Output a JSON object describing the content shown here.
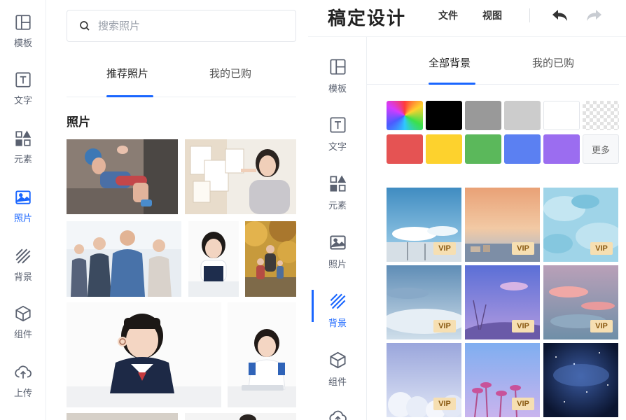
{
  "left_rail": {
    "items": [
      {
        "label": "模板",
        "icon": "layout-icon"
      },
      {
        "label": "文字",
        "icon": "text-icon"
      },
      {
        "label": "元素",
        "icon": "elements-icon"
      },
      {
        "label": "照片",
        "icon": "image-icon"
      },
      {
        "label": "背景",
        "icon": "background-icon"
      },
      {
        "label": "组件",
        "icon": "cube-icon"
      },
      {
        "label": "上传",
        "icon": "upload-icon"
      }
    ],
    "active_index": 3
  },
  "left_panel": {
    "search": {
      "placeholder": "搜索照片",
      "value": ""
    },
    "tabs": [
      {
        "label": "推荐照片"
      },
      {
        "label": "我的已购"
      }
    ],
    "active_tab": 0,
    "section_title": "照片"
  },
  "editor": {
    "brand": "稿定设计",
    "menu": [
      {
        "label": "文件"
      },
      {
        "label": "视图"
      }
    ],
    "right_rail": {
      "items": [
        {
          "label": "模板",
          "icon": "layout-icon"
        },
        {
          "label": "文字",
          "icon": "text-icon"
        },
        {
          "label": "元素",
          "icon": "elements-icon"
        },
        {
          "label": "照片",
          "icon": "image-icon"
        },
        {
          "label": "背景",
          "icon": "background-icon"
        },
        {
          "label": "组件",
          "icon": "cube-icon"
        }
      ],
      "active_index": 4
    },
    "bg_tabs": [
      {
        "label": "全部背景"
      },
      {
        "label": "我的已购"
      }
    ],
    "active_bg_tab": 0,
    "swatches": [
      {
        "color": "rainbow-gradient"
      },
      {
        "color": "#000000"
      },
      {
        "color": "#999999"
      },
      {
        "color": "#cccccc"
      },
      {
        "color": "#ffffff"
      },
      {
        "color": "transparent"
      },
      {
        "color": "#e55353"
      },
      {
        "color": "#fdd22d"
      },
      {
        "color": "#5bb85b"
      },
      {
        "color": "#5b80f2"
      },
      {
        "color": "#9b6df0"
      }
    ],
    "more_label": "更多",
    "vip_label": "VIP"
  },
  "colors": {
    "accent": "#1a66ff",
    "vip_bg": "#f6dfb2",
    "vip_text": "#8a5a12"
  }
}
